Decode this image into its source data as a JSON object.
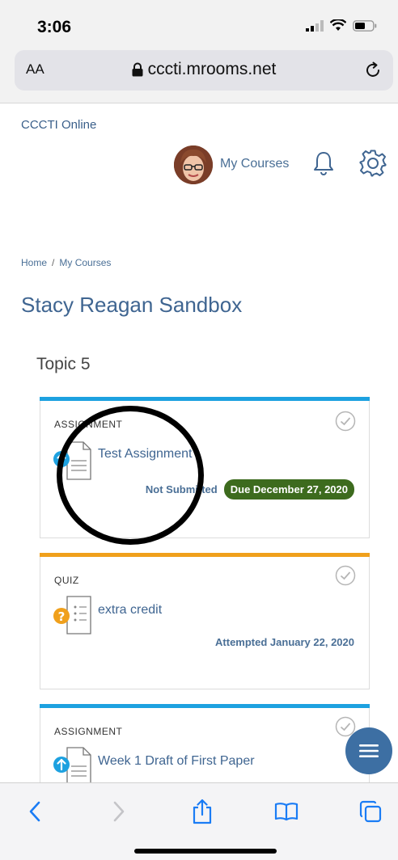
{
  "status_bar": {
    "time": "3:06"
  },
  "browser": {
    "text_size_label": "AA",
    "url": "cccti.mrooms.net"
  },
  "site": {
    "name": "CCCTI Online"
  },
  "nav": {
    "my_courses": "My Courses"
  },
  "breadcrumb": {
    "home": "Home",
    "separator": "/",
    "current": "My Courses"
  },
  "page": {
    "title": "Stacy Reagan Sandbox"
  },
  "topic": {
    "title": "Topic 5"
  },
  "activities": [
    {
      "type": "ASSIGNMENT",
      "name": "Test Assignment",
      "status": "Not Submitted",
      "due": "Due December 27, 2020",
      "accent_color": "#1da1e0"
    },
    {
      "type": "QUIZ",
      "name": "extra credit",
      "status": "Attempted January 22, 2020",
      "accent_color": "#f0a01c"
    },
    {
      "type": "ASSIGNMENT",
      "name": "Week 1 Draft of First Paper",
      "accent_color": "#1da1e0"
    }
  ],
  "colors": {
    "link": "#3f6591",
    "due_badge": "#3d6b1e",
    "fab": "#3d6fa3",
    "ios_blue": "#1a7cf5"
  }
}
